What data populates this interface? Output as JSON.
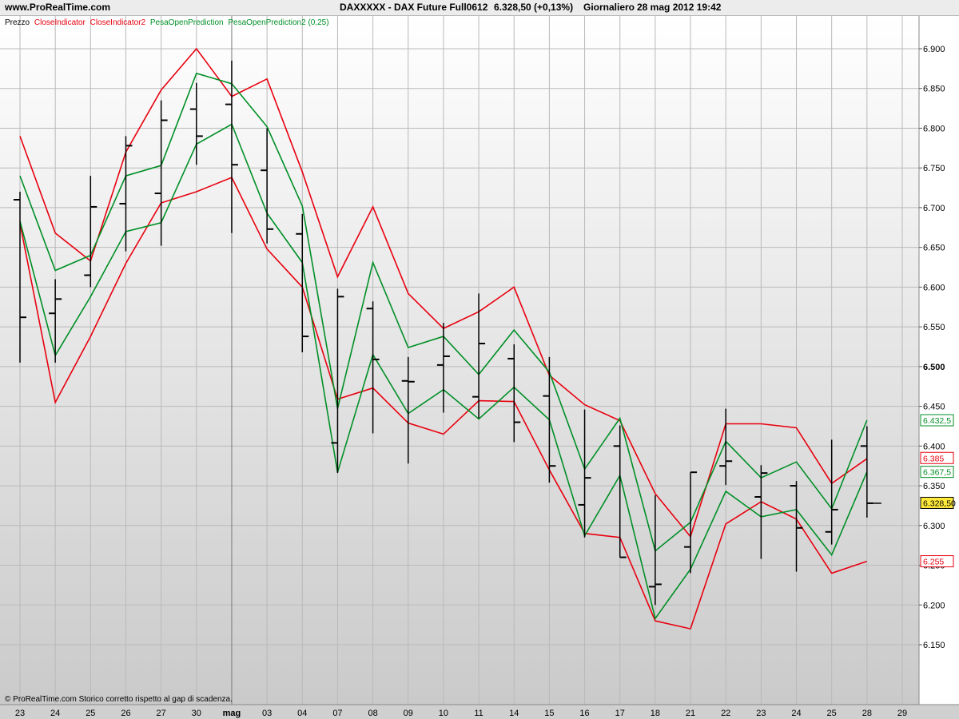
{
  "header": {
    "site": "www.ProRealTime.com",
    "instrument": "DAXXXXX - DAX Future Full0612",
    "last_price": "6.328,50 (+0,13%)",
    "period": "Giornaliero",
    "datetime": "28 mag 2012 19:42"
  },
  "legend": {
    "price": "Prezzo",
    "ind1": "CloseIndicator",
    "ind2": "CloseIndicator2",
    "ind3": "PesaOpenPrediction",
    "ind4": "PesaOpenPrediction2 (0,25)"
  },
  "footer_note": "© ProRealTime.com Storico corretto rispetto al gap di scadenza.",
  "colors": {
    "red": "#e8000e",
    "green": "#008f26",
    "bar": "#000000",
    "price_tag": "#ffea3a"
  },
  "chart_data": {
    "type": "ohlc",
    "ylim": [
      6130,
      6930
    ],
    "y_ticks": [
      "6.150",
      "6.200",
      "6.250",
      "6.300",
      "6.350",
      "6.400",
      "6.450",
      "6.500",
      "6.550",
      "6.600",
      "6.650",
      "6.700",
      "6.750",
      "6.800",
      "6.850",
      "6.900"
    ],
    "y_tick_values": [
      6150,
      6200,
      6250,
      6300,
      6350,
      6400,
      6450,
      6500,
      6550,
      6600,
      6650,
      6700,
      6750,
      6800,
      6850,
      6900
    ],
    "x_labels": [
      "23",
      "24",
      "25",
      "26",
      "27",
      "30",
      "mag",
      "03",
      "04",
      "07",
      "08",
      "09",
      "10",
      "11",
      "14",
      "15",
      "16",
      "17",
      "18",
      "21",
      "22",
      "23",
      "24",
      "25",
      "28",
      "29"
    ],
    "bars": [
      {
        "open": 6710,
        "high": 6720,
        "low": 6505,
        "close": 6562
      },
      {
        "open": 6567,
        "high": 6610,
        "low": 6505,
        "close": 6585
      },
      {
        "open": 6615,
        "high": 6740,
        "low": 6600,
        "close": 6701
      },
      {
        "open": 6705,
        "high": 6790,
        "low": 6645,
        "close": 6778
      },
      {
        "open": 6718,
        "high": 6835,
        "low": 6652,
        "close": 6810
      },
      {
        "open": 6824,
        "high": 6857,
        "low": 6754,
        "close": 6790
      },
      {
        "open": 6830,
        "high": 6885,
        "low": 6668,
        "close": 6754
      },
      {
        "open": 6747,
        "high": 6800,
        "low": 6655,
        "close": 6673
      },
      {
        "open": 6667,
        "high": 6692,
        "low": 6518,
        "close": 6538
      },
      {
        "open": 6404,
        "high": 6598,
        "low": 6366,
        "close": 6588
      },
      {
        "open": 6573,
        "high": 6582,
        "low": 6416,
        "close": 6509
      },
      {
        "open": 6482,
        "high": 6512,
        "low": 6378,
        "close": 6481
      },
      {
        "open": 6502,
        "high": 6555,
        "low": 6442,
        "close": 6513
      },
      {
        "open": 6462,
        "high": 6592,
        "low": 6435,
        "close": 6529
      },
      {
        "open": 6510,
        "high": 6528,
        "low": 6405,
        "close": 6430
      },
      {
        "open": 6463,
        "high": 6512,
        "low": 6354,
        "close": 6375
      },
      {
        "open": 6326,
        "high": 6446,
        "low": 6285,
        "close": 6360
      },
      {
        "open": 6400,
        "high": 6426,
        "low": 6260,
        "close": 6260
      },
      {
        "open": 6223,
        "high": 6338,
        "low": 6200,
        "close": 6226
      },
      {
        "open": 6273,
        "high": 6367,
        "low": 6240,
        "close": 6367
      },
      {
        "open": 6375,
        "high": 6447,
        "low": 6351,
        "close": 6381
      },
      {
        "open": 6336,
        "high": 6376,
        "low": 6258,
        "close": 6366
      },
      {
        "open": 6350,
        "high": 6356,
        "low": 6242,
        "close": 6297
      },
      {
        "open": 6292,
        "high": 6408,
        "low": 6276,
        "close": 6320
      },
      {
        "open": 6400,
        "high": 6425,
        "low": 6310,
        "close": 6328
      }
    ],
    "series": [
      {
        "name": "CloseIndicator",
        "color": "#e8000e",
        "values": [
          6790,
          6668,
          6633,
          6770,
          6848,
          6900,
          6840,
          6862,
          6745,
          6613,
          6701,
          6592,
          6548,
          6569,
          6600,
          6489,
          6452,
          6432,
          6340,
          6286,
          6428,
          6428,
          6423,
          6353,
          6384
        ]
      },
      {
        "name": "CloseIndicator2",
        "color": "#e8000e",
        "values": [
          6680,
          6455,
          6538,
          6630,
          6706,
          6720,
          6738,
          6648,
          6600,
          6459,
          6473,
          6429,
          6415,
          6457,
          6456,
          6370,
          6290,
          6285,
          6180,
          6170,
          6302,
          6330,
          6308,
          6240,
          6255
        ]
      },
      {
        "name": "PesaOpenPrediction",
        "color": "#008f26",
        "values": [
          6740,
          6621,
          6640,
          6740,
          6753,
          6869,
          6856,
          6802,
          6702,
          6447,
          6631,
          6524,
          6538,
          6490,
          6546,
          6493,
          6371,
          6435,
          6268,
          6304,
          6406,
          6360,
          6380,
          6321,
          6432.5
        ]
      },
      {
        "name": "PesaOpenPrediction2 (0,25)",
        "color": "#008f26",
        "values": [
          6683,
          6514,
          6588,
          6670,
          6681,
          6780,
          6805,
          6693,
          6631,
          6367,
          6515,
          6441,
          6471,
          6434,
          6474,
          6433,
          6287,
          6363,
          6183,
          6245,
          6343,
          6311,
          6320,
          6263,
          6367.5
        ]
      }
    ],
    "last_value_tags": [
      {
        "label": "6.432,5",
        "value": 6432.5,
        "color": "#008f26"
      },
      {
        "label": "6.385",
        "value": 6385,
        "color": "#e8000e"
      },
      {
        "label": "6.367,5",
        "value": 6367.5,
        "color": "#008f26"
      },
      {
        "label": "6.328,50",
        "value": 6328.5,
        "color": "#000000",
        "highlight": true
      },
      {
        "label": "6.255",
        "value": 6255,
        "color": "#e8000e"
      }
    ],
    "grid": true
  }
}
